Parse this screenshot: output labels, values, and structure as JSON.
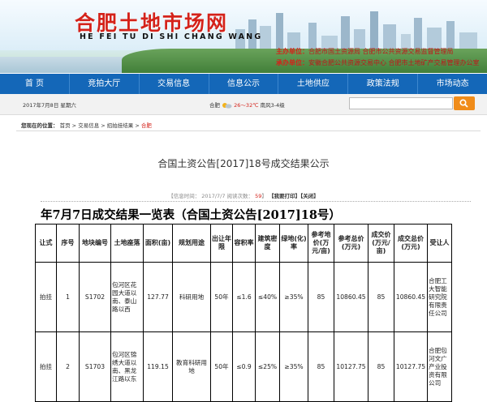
{
  "site": {
    "title": "合肥土地市场网",
    "subtitle": "HE FEI TU DI SHI CHANG WANG",
    "sponsor_label": "主办单位：",
    "sponsor_value": "合肥市国土资源局 合肥市公共资源交易监督管理局",
    "organizer_label": "承办单位：",
    "organizer_value": "安徽合肥公共资源交易中心 合肥市土地矿产交易管理办公室"
  },
  "nav": [
    "首 页",
    "竞拍大厅",
    "交易信息",
    "信息公示",
    "土地供应",
    "政策法规",
    "市场动态"
  ],
  "infobar": {
    "date": "2017年7月8日  星期六",
    "city": "合肥",
    "temp": "26～32℃",
    "wind": "南风3-4级",
    "search_placeholder": ""
  },
  "breadcrumb": {
    "label": "您现在的位置：",
    "items": [
      "首页",
      "交易信息",
      "招拍挂结果"
    ],
    "current": "合肥",
    "sep": ">"
  },
  "article": {
    "title": "合国土资公告[2017]18号成交结果公示",
    "meta_date": "【信息时间：  2017/7/7   阅读次数：",
    "meta_count": "59",
    "meta_end": "】",
    "print_label": "【我要打印】",
    "close_label": "【关闭】",
    "table_title": "年7月7日成交结果一览表（合国土资公告[2017]18号）"
  },
  "table": {
    "headers": [
      "让式",
      "序号",
      "地块编号",
      "土地座落",
      "面积(亩)",
      "规划用途",
      "出让年限",
      "容积率",
      "建筑密度",
      "绿地(化)率",
      "参考地价(万元/亩)",
      "参考总价(万元)",
      "成交价(万元/亩)",
      "成交总价(万元)",
      "受让人"
    ],
    "rows": [
      [
        "拍挂",
        "1",
        "S1702",
        "包河区花园大道以南、泰山路以西",
        "127.77",
        "科研用地",
        "50年",
        "≤1.6",
        "≤40%",
        "≥35%",
        "85",
        "10860.45",
        "85",
        "10860.45",
        "合肥工大智能研究院有限责任公司"
      ],
      [
        "拍挂",
        "2",
        "S1703",
        "包河区锦绣大道以南、黑龙江路以东",
        "119.15",
        "教育科研用地",
        "50年",
        "≤0.9",
        "≤25%",
        "≥35%",
        "85",
        "10127.75",
        "85",
        "10127.75",
        "合肥包河文广产业投资有限公司"
      ]
    ]
  },
  "colors": {
    "nav": "#1467b8",
    "brand_red": "#d4221a",
    "search_button": "#f08c1a"
  },
  "icons": [
    "weather-icon",
    "search-icon"
  ]
}
